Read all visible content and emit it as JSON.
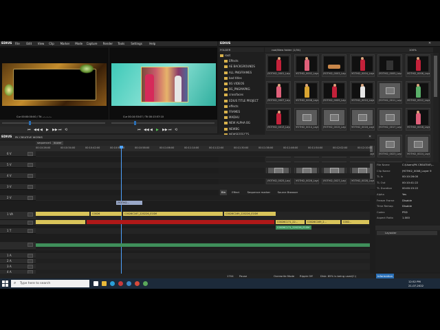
{
  "app": {
    "name": "EDIUS"
  },
  "menu": [
    "File",
    "Edit",
    "View",
    "Clip",
    "Marker",
    "Mode",
    "Capture",
    "Render",
    "Tools",
    "Settings",
    "Help"
  ],
  "player": {
    "timecode_in": "Cur 00:00:00:00",
    "timecode_out": "Ttl 00:00:00:00",
    "label": "Cur 00:00:00:00 / Ttl --:--:--:--"
  },
  "recorder": {
    "label": "Cur 00:10:53:07 / Ttl 00:13:57:10"
  },
  "bin": {
    "title": "EDIUS",
    "folder_header": "FOLDER",
    "path": "root/New folder (1/34)",
    "zoom": "100%",
    "folders": [
      "root",
      "Effects",
      "AE BACKGROUNDS",
      "ALL PNGFRAMES",
      "bad titles",
      "BG VIDEOS",
      "BG_PNGMAPKG",
      "crossfaces",
      "EDIUS TITLE PROJECT",
      "effects",
      "FRAMES",
      "MADHU",
      "NEW ALPHA BG",
      "NEWBG",
      "NEWSEFFECTS",
      "new",
      "New folder",
      "SONGS"
    ],
    "tabs": [
      "Bin",
      "Effect",
      "Sequence marker",
      "Source Browser"
    ],
    "clips": [
      "JYOTHI2_0001_Layer 3",
      "JYOTHI2_0002_Layer 4",
      "JYOTHI2_0003_Layer 5",
      "JYOTHI2_0004_Layer 6",
      "JYOTHI2_0005_Layer 7",
      "JYOTHI2_0006_Layer 8",
      "JYOTHI2_0007_Layer 9",
      "JYOTHI2_0008_Layer 10",
      "JYOTHI2_0009_Layer 11",
      "JYOTHI2_0010_Layer 12",
      "JYOTHI2_0011_Layer 13",
      "JYOTHI2_0012_Layer 14",
      "JYOTHI2_0013_Layer 15",
      "JYOTHI2_0014_Layer 16",
      "JYOTHI2_0015_Layer 17",
      "JYOTHI2_0016_Layer 18",
      "JYOTHI2_0017_Layer 19",
      "JYOTHI2_0018_Layer 20",
      "JYOTHI2_0019_Layer 21",
      "JYOTHI2_0020_Layer 22",
      "JYOTHI2_0021_Layer 23",
      "JYOTHI2_0022_Layer 24",
      "JYOTHI2_0023_Layer 25",
      "JYOTHI2_0024_Layer 26",
      "JYOTHI2_0025_Layer 27",
      "JYOTHI2_0026_Layer 28",
      "JYOTHI2_0027_Layer 29",
      "JYOTHI2_0028_Layer 30",
      "JYOTHI2_0029_Layer 31",
      "JYOTHI2_0030_Layer 32"
    ]
  },
  "timeline": {
    "title": "EDIUS",
    "project": "PK CREATIVE WORKS",
    "tabs": [
      "sequence1",
      "dower"
    ],
    "ruler": [
      "00:10:26:00",
      "00:10:34:00",
      "00:10:42:00",
      "00:10:50:00",
      "00:10:58:00",
      "00:11:06:00",
      "00:11:14:00",
      "00:11:22:00",
      "00:11:30:00",
      "00:11:38:00",
      "00:11:46:00",
      "00:11:54:00",
      "00:12:02:00",
      "00:12:10:00"
    ],
    "tracks": [
      "6 V",
      "5 V",
      "4 V",
      "3 V",
      "2 V",
      "1 VA",
      "",
      "1 T",
      "",
      "1 A",
      "2 A",
      "3 A",
      "4 A"
    ],
    "clips": {
      "title": "JYOTHI2...",
      "v2_a": "C0026",
      "v2_b": "C0026C167_220226_E1SM",
      "v2_c": "C0026C169_220226_E1SM",
      "v1_a": "C0026C171_22...",
      "v1_b": "C0026C169_2...",
      "v1_c": "C0026C171_220226_E1SM",
      "v1_d": "C002..."
    }
  },
  "info": {
    "rows": [
      {
        "k": "File Name",
        "v": "C:\\Users\\PK CREATIVE\\..."
      },
      {
        "k": "Clip Name",
        "v": "JYOTHI2_0008_Layer 9"
      },
      {
        "k": "TL In",
        "v": "00:10:26:00"
      },
      {
        "k": "TL Out",
        "v": "00:10:41:22"
      },
      {
        "k": "TL Duration",
        "v": "00:00:15:22"
      },
      {
        "k": "Alpha",
        "v": "Yes"
      },
      {
        "k": "Freeze Frame",
        "v": "Disable"
      },
      {
        "k": "Time Remap",
        "v": "Disable"
      },
      {
        "k": "Codec",
        "v": "PSD"
      },
      {
        "k": "Aspect Ratio",
        "v": "1.000"
      }
    ],
    "section": "Layouter",
    "tab": "Information"
  },
  "status": {
    "frame": "1704",
    "mode": "Pause",
    "overwrite": "Overwrite Mode",
    "ripple": "Ripple Off",
    "disk": "Disk: 85% is being used(C:)"
  },
  "taskbar": {
    "search_placeholder": "Type here to search",
    "time": "12:52 PM",
    "date": "21-07-2022"
  },
  "colors": {
    "accent": "#2b6fb5",
    "clip_yellow": "#d9c45a",
    "clip_red": "#b01818",
    "audio_green": "#3f8f5a"
  }
}
